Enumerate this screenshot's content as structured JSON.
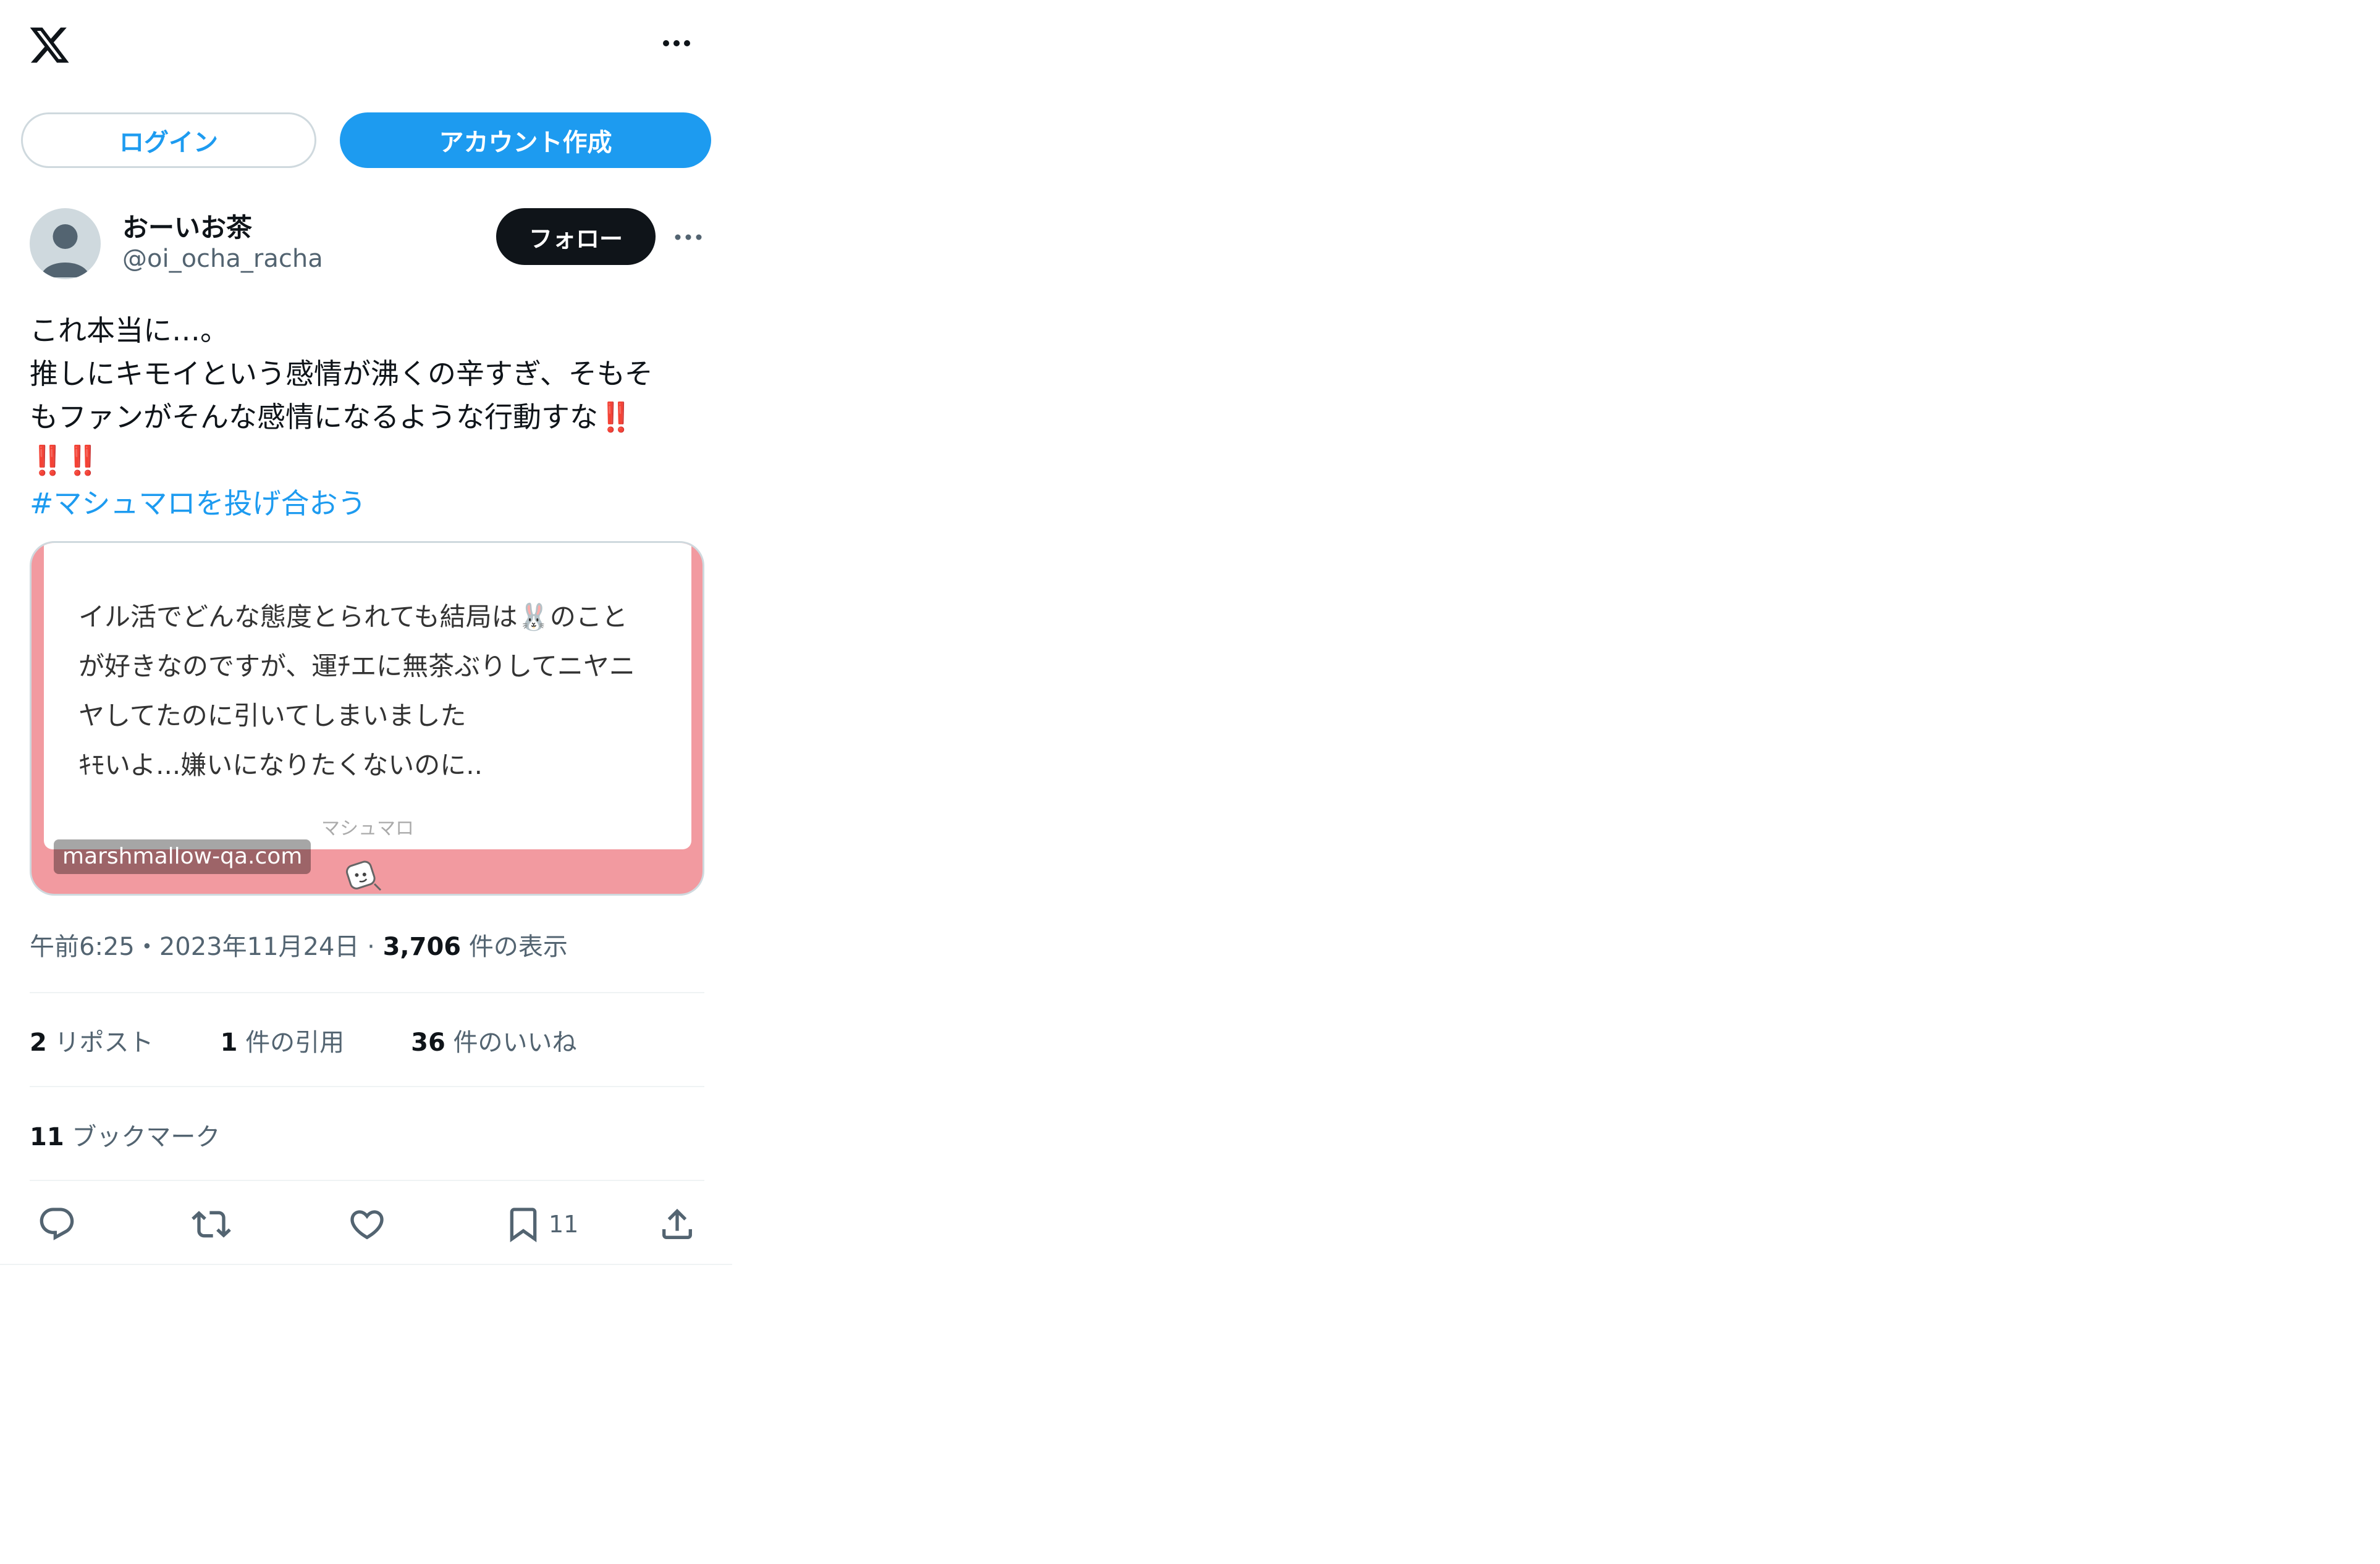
{
  "header": {
    "logo": "x-logo-icon",
    "more": "more-dots-icon"
  },
  "auth": {
    "login_label": "ログイン",
    "signup_label": "アカウント作成"
  },
  "author": {
    "display_name": "おーいお茶",
    "handle": "@oi_ocha_racha",
    "follow_label": "フォロー",
    "avatar": "default-avatar-icon"
  },
  "tweet": {
    "lines": [
      "これ本当に…。",
      "推しにキモイという感情が沸くの辛すぎ、そもそ",
      "もファンがそんな感情になるような行動すな"
    ],
    "bangs_inline": "‼️",
    "bangs_line": "‼️‼️",
    "hashtag": "#マシュマロを投げ合おう"
  },
  "card": {
    "lines": [
      "イル活でどんな態度とられても結局は🐰のこと",
      "が好きなのですが、運ﾁエに無茶ぶりしてニヤニ",
      "ヤしてたのに引いてしまいました",
      "ｷﾓいよ...嫌いになりたくないのに.."
    ],
    "brand": "マシュマロ",
    "domain": "marshmallow-qa.com",
    "accent_color": "#f29aa0"
  },
  "meta": {
    "time": "午前6:25",
    "sep1": "・",
    "date": "2023年11月24日",
    "sep2": " · ",
    "views_count": "3,706",
    "views_label": " 件の表示"
  },
  "stats": {
    "reposts_count": "2",
    "reposts_label": " リポスト",
    "quotes_count": "1",
    "quotes_label": " 件の引用",
    "likes_count": "36",
    "likes_label": " 件のいいね",
    "bookmarks_count": "11",
    "bookmarks_label": " ブックマーク"
  },
  "actions": {
    "reply": "reply-icon",
    "repost": "repost-icon",
    "like": "like-icon",
    "bookmark": "bookmark-icon",
    "bookmark_count": "11",
    "share": "share-icon"
  },
  "colors": {
    "link": "#1d9bf0",
    "text": "#0f1419",
    "secondary": "#536471",
    "border": "#cfd9de"
  }
}
